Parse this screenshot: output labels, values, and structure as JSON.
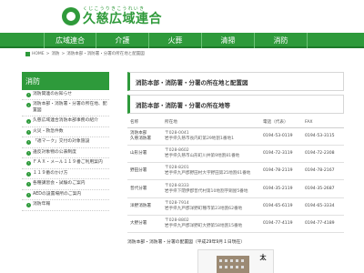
{
  "header": {
    "logo_ruby": "くじこうりきこうれいき",
    "logo_title": "久慈広域連合"
  },
  "nav": {
    "items": [
      "広域連合",
      "介護",
      "火葬",
      "清掃",
      "消防"
    ]
  },
  "breadcrumb": {
    "home": "HOME",
    "separator": ">",
    "items": [
      "消防",
      "消防本部・消防署・分署の所在地と配置図"
    ]
  },
  "sidebar": {
    "heading": "消防",
    "items": [
      "消防関連のお知らせ",
      "消防本部・消防署・分署の所在地、配置図",
      "久慈広域連合消防本部事務の紹介",
      "火災・救急件数",
      "「適マーク」交付の対象施設",
      "違反対象物の公表制度",
      "ＦＡＸ・メール１１９番ご利用案内",
      "１１９番のかけ方",
      "各種講習会・試験のご案内",
      "AEDの設置場所のご案内",
      "消防年報"
    ]
  },
  "main": {
    "title1": "消防本部・消防署・分署の所在地と配置図",
    "title2": "消防本部・消防署・分署の所在地等",
    "table": {
      "headers": [
        "名称",
        "所在地",
        "電話（代表）",
        "FAX"
      ],
      "rows": [
        {
          "name": "消防本部\n久慈消防署",
          "postal": "〒028-0041",
          "address": "岩手県久慈市長内町第29地割1番地1",
          "tel": "0194-53-0119",
          "fax": "0194-53-3115"
        },
        {
          "name": "山形分署",
          "postal": "〒028-8602",
          "address": "岩手県久慈市山形町川井第9地割81番地",
          "tel": "0194-72-3119",
          "fax": "0194-72-2308"
        },
        {
          "name": "野田分署",
          "postal": "〒028-8201",
          "address": "岩手県九戸郡野田村大字野田第25地割61番地",
          "tel": "0194-78-2119",
          "fax": "0194-78-2167"
        },
        {
          "name": "普代分署",
          "postal": "〒028-8333",
          "address": "岩手県下閉伊郡普代村第10地割字銅屋5番地",
          "tel": "0194-35-2119",
          "fax": "0194-35-2687"
        },
        {
          "name": "洋野消防署",
          "postal": "〒028-7914",
          "address": "岩手県九戸郡洋野町種市第23地割62番地",
          "tel": "0194-65-6119",
          "fax": "0194-65-3334"
        },
        {
          "name": "大野分署",
          "postal": "〒028-8802",
          "address": "岩手県九戸郡洋野町大野第58地割15番地",
          "tel": "0194-77-4119",
          "fax": "0194-77-4189"
        }
      ]
    },
    "map_caption": "消防本部・消防署・分署の配置図（平成29年9月１日現在）",
    "map_label": "太"
  }
}
